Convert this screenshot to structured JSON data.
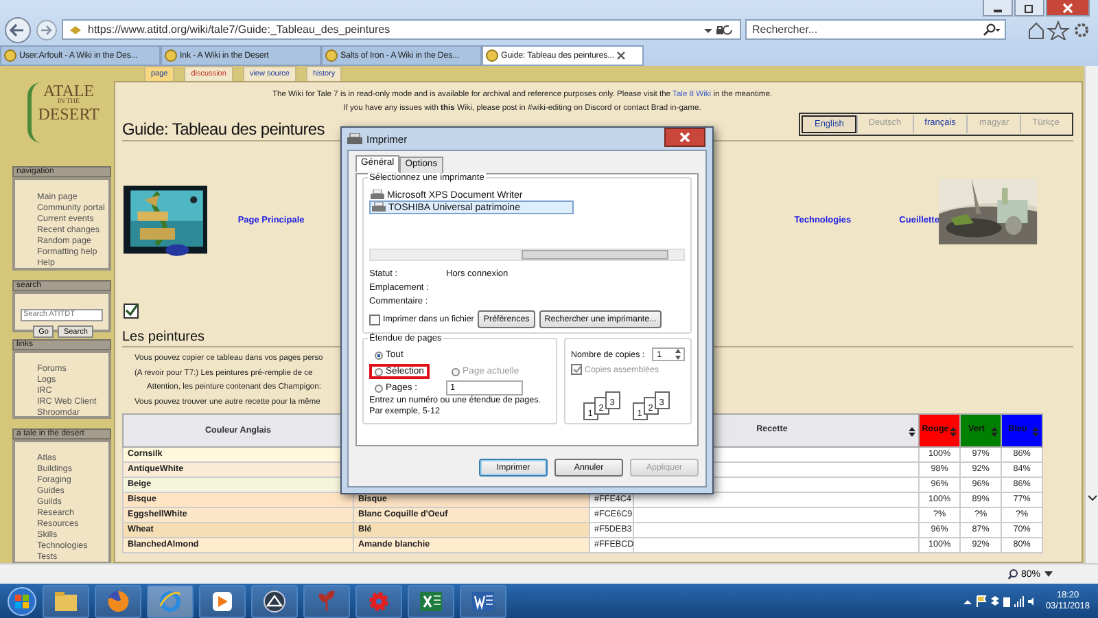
{
  "browser": {
    "address": "https://www.atitd.org/wiki/tale7/Guide:_Tableau_des_peintures",
    "search_placeholder": "Rechercher...",
    "tabs": [
      {
        "title": "User:Arfoult - A Wiki in the Des...",
        "selected": false
      },
      {
        "title": "Ink - A Wiki in the Desert",
        "selected": false
      },
      {
        "title": "Salts of Iron - A Wiki in the Des...",
        "selected": false
      },
      {
        "title": "Guide: Tableau des peintures...",
        "selected": true
      }
    ]
  },
  "page_tabs": [
    {
      "label": "page",
      "selected": true,
      "missing": false
    },
    {
      "label": "discussion",
      "selected": false,
      "missing": true
    },
    {
      "label": "view source",
      "selected": false,
      "missing": false
    },
    {
      "label": "history",
      "selected": false,
      "missing": false
    }
  ],
  "logo": [
    "ATALE",
    "IN THE",
    "DESERT"
  ],
  "sidebar": [
    {
      "title": "navigation",
      "kind": "links",
      "items": [
        "Main page",
        "Community portal",
        "Current events",
        "Recent changes",
        "Random page",
        "Formatting help",
        "Help"
      ]
    },
    {
      "title": "search",
      "kind": "search",
      "placeholder": "Search ATITDT",
      "buttons": [
        "Go",
        "Search"
      ]
    },
    {
      "title": "links",
      "kind": "links",
      "items": [
        "Forums",
        "Logs",
        "IRC",
        "IRC Web Client",
        "Shroomdar"
      ]
    },
    {
      "title": "a tale in the desert",
      "kind": "links",
      "items": [
        "Atlas",
        "Buildings",
        "Foraging",
        "Guides",
        "Guilds",
        "Research",
        "Resources",
        "Skills",
        "Technologies",
        "Tests"
      ]
    }
  ],
  "notice": {
    "line1": "The Wiki for Tale 7 is in read-only mode and is available for archival and reference purposes only. Please visit the",
    "link": "Tale 8 Wiki",
    "line1_end": "in the meantime.",
    "line2": "If you have any issues with **this** Wiki, please post in #wiki-editing on Discord or contact Brad in-game."
  },
  "languages": [
    {
      "label": "English",
      "selected": true,
      "disabled": false
    },
    {
      "label": "Deutsch",
      "selected": false,
      "disabled": true
    },
    {
      "label": "français",
      "selected": false,
      "disabled": false
    },
    {
      "label": "magyar",
      "selected": false,
      "disabled": true
    },
    {
      "label": "Türkçe",
      "selected": false,
      "disabled": true
    }
  ],
  "title": "Guide: Tableau des peintures",
  "nav_links": [
    "Page Principale",
    "Technologies",
    "Cueillette"
  ],
  "heading": "Les peintures",
  "bullets": [
    {
      "text": "Vous pouvez copier ce tableau dans vos pages perso"
    },
    {
      "text": "(A revoir pour T7:) Les peintures pré-remplie de ce",
      "children": [
        {
          "text": "Attention, les peinture contenant des Champigon:"
        }
      ]
    },
    {
      "text": "Vous pouvez trouver une autre recette pour la même"
    }
  ],
  "table": {
    "columns": [
      {
        "label": "Couleur Anglais",
        "sortable": false
      },
      {
        "label": "Recette",
        "sortable": true
      },
      {
        "label": "Rouge",
        "sortable": true,
        "color": "#ff0000"
      },
      {
        "label": "Vert",
        "sortable": true,
        "color": "#008000"
      },
      {
        "label": "Bleu",
        "sortable": true,
        "color": "#0000ff"
      }
    ],
    "rows": [
      {
        "english": "Cornsilk",
        "color": "#fff8dc",
        "rouge": "100%",
        "vert": "97%",
        "bleu": "86%"
      },
      {
        "english": "AntiqueWhite",
        "color": "#faebd7",
        "rouge": "98%",
        "vert": "92%",
        "bleu": "84%"
      },
      {
        "english": "Beige",
        "color": "#f5f5dc",
        "rouge": "96%",
        "vert": "96%",
        "bleu": "86%"
      },
      {
        "english": "Bisque",
        "french": "Bisque",
        "hex": "#FFE4C4",
        "color": "#ffe4c4",
        "rouge": "100%",
        "vert": "89%",
        "bleu": "77%"
      },
      {
        "english": "EggshellWhite",
        "french": "Blanc Coquille d'Oeuf",
        "hex": "#FCE6C9",
        "color": "#fce6c9",
        "rouge": "?%",
        "vert": "?%",
        "bleu": "?%"
      },
      {
        "english": "Wheat",
        "french": "Blé",
        "hex": "#F5DEB3",
        "color": "#f5deb3",
        "rouge": "96%",
        "vert": "87%",
        "bleu": "70%"
      },
      {
        "english": "BlanchedAlmond",
        "french": "Amande blanchie",
        "hex": "#FFEBCD",
        "color": "#ffebcd",
        "rouge": "100%",
        "vert": "92%",
        "bleu": "80%"
      }
    ]
  },
  "print_dialog": {
    "title": "Imprimer",
    "tabs": [
      {
        "label": "Général",
        "selected": true
      },
      {
        "label": "Options",
        "selected": false
      }
    ],
    "printer_group": "Sélectionnez une imprimante",
    "printers": [
      {
        "name": "Microsoft XPS Document Writer",
        "selected": false
      },
      {
        "name": "TOSHIBA Universal patrimoine",
        "selected": true
      }
    ],
    "status": [
      {
        "label": "Statut :",
        "value": "Hors connexion"
      },
      {
        "label": "Emplacement :"
      },
      {
        "label": "Commentaire :"
      }
    ],
    "print_to_file": {
      "label": "Imprimer dans un fichier",
      "checked": false
    },
    "printer_buttons": [
      "Préférences",
      "Rechercher une imprimante..."
    ],
    "range_group": "Étendue de pages",
    "ranges": [
      {
        "label": "Tout",
        "selected": true,
        "disabled": false,
        "highlighted": false
      },
      {
        "label": "Sélection",
        "selected": false,
        "disabled": false,
        "highlighted": true
      },
      {
        "label": "Page actuelle",
        "selected": false,
        "disabled": true,
        "highlighted": false
      },
      {
        "label": "Pages :",
        "selected": false,
        "disabled": false,
        "highlighted": false
      }
    ],
    "pages_value": "1",
    "range_hint": [
      "Entrez un numéro ou une étendue de pages.",
      "Par exemple, 5-12"
    ],
    "copies_label": "Nombre de copies :",
    "copies_value": "1",
    "collate": {
      "label": "Copies assemblées",
      "checked": true,
      "disabled": true
    },
    "collate_icons": [
      [
        "1",
        "2",
        "3"
      ],
      [
        "1",
        "2",
        "3"
      ]
    ],
    "buttons": [
      {
        "label": "Imprimer",
        "default": true,
        "disabled": false
      },
      {
        "label": "Annuler",
        "default": false,
        "disabled": false
      },
      {
        "label": "Appliquer",
        "default": false,
        "disabled": true
      }
    ]
  },
  "status_bar": {
    "zoom": "80%"
  },
  "taskbar": {
    "time": "18:20",
    "date": "03/11/2018"
  }
}
